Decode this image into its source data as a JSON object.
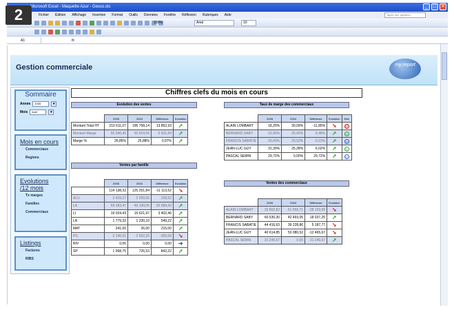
{
  "overlay_badge": "2",
  "window": {
    "title": "Microsoft Excel - Maquette Azur - Gesco.xls",
    "controls": [
      "_",
      "□",
      "✕"
    ]
  },
  "menu": [
    "Fichier",
    "Édition",
    "Affichage",
    "Insertion",
    "Format",
    "Outils",
    "Données",
    "Fenêtre",
    "Réflexion",
    "Rubriques",
    "Aide"
  ],
  "help_placeholder": "Tapez une question",
  "toolbar": {
    "zoom": "100%",
    "font": "Arial",
    "size": "10"
  },
  "formula_bar": {
    "cell": "A1",
    "fx": "fx"
  },
  "header": {
    "title": "Gestion commerciale",
    "logo": "my report"
  },
  "nav": {
    "sommaire": {
      "title": "Sommaire",
      "annee_label": "Année",
      "annee_value": "2005",
      "mois_label": "Mois",
      "mois_value": "Avril"
    },
    "ventes": {
      "title": "Mois en cours",
      "items": [
        "Commerciaux",
        "Regions"
      ]
    },
    "evolutions": {
      "title": "Evolutions",
      "subtitle": "/12 mois",
      "items": [
        "Tx marges",
        "Familles",
        "Commerciaux"
      ]
    },
    "listings": {
      "title": "Listings",
      "items": [
        "Factures",
        "RIBS"
      ]
    }
  },
  "main_title": "Chiffres clefs du mois en cours",
  "evolution": {
    "title": "Evolution des ventes",
    "headers": [
      "2005",
      "2004",
      "Différence",
      "Evolution"
    ],
    "rows": [
      {
        "label": "Montant Total HT",
        "v2005": "210 611,07",
        "v2004": "196 758,14",
        "diff": "13 852,93",
        "trend": "up",
        "alt": false
      },
      {
        "label": "Montant Marge",
        "v2005": "56 546,40",
        "v2004": "50 914,56",
        "diff": "5 631,84",
        "trend": "up",
        "alt": true
      },
      {
        "label": "Marge %",
        "v2005": "26,85%",
        "v2004": "25,88%",
        "diff": "0,97%",
        "trend": "up",
        "alt": false
      }
    ]
  },
  "familles": {
    "title": "Ventes par famille",
    "headers": [
      "2005",
      "2004",
      "Différence",
      "Evolution"
    ],
    "rows": [
      {
        "label": "",
        "v2005": "114 138,32",
        "v2004": "125 251,84",
        "diff": "-11 113,52",
        "trend": "down",
        "alt": false
      },
      {
        "label": "ALU",
        "v2005": "2 429,27",
        "v2004": "2 200,65",
        "diff": "228,62",
        "trend": "up",
        "alt": true
      },
      {
        "label": "LA",
        "v2005": "69 283,47",
        "v2004": "49 199,05",
        "diff": "20 084,42",
        "trend": "up",
        "alt": true
      },
      {
        "label": "LI",
        "v2005": "19 024,43",
        "v2004": "15 621,97",
        "diff": "3 402,46",
        "trend": "up",
        "alt": false
      },
      {
        "label": "LR",
        "v2005": "1 779,32",
        "v2004": "1 230,10",
        "diff": "549,22",
        "trend": "up",
        "alt": false
      },
      {
        "label": "MAT",
        "v2005": "241,00",
        "v2004": "26,00",
        "diff": "215,00",
        "trend": "up",
        "alt": false
      },
      {
        "label": "PS",
        "v2005": "2 146,51",
        "v2004": "2 502,20",
        "diff": "-355,69",
        "trend": "down",
        "alt": true
      },
      {
        "label": "RIV",
        "v2005": "0,00",
        "v2004": "0,00",
        "diff": "0,00",
        "trend": "flat",
        "alt": false
      },
      {
        "label": "SP",
        "v2005": "1 568,75",
        "v2004": "726,53",
        "diff": "842,22",
        "trend": "up",
        "alt": false
      }
    ]
  },
  "taux": {
    "title": "Taux de marge des commerciaux",
    "headers": [
      "2005",
      "2004",
      "Différence",
      "Evolution",
      "Etat"
    ],
    "rows": [
      {
        "label": "ALAIN LOMBART",
        "v2005": "18,25%",
        "v2004": "30,09%",
        "diff": "-11,85%",
        "trend": "down",
        "state": "bad",
        "alt": false
      },
      {
        "label": "BERNARD SABY",
        "v2005": "31,80%",
        "v2004": "25,42%",
        "diff": "6,48%",
        "trend": "up",
        "state": "good",
        "alt": true
      },
      {
        "label": "FRANCIS SABATIE",
        "v2005": "20,43%",
        "v2004": "20,53%",
        "diff": "-0,10%",
        "trend": "up",
        "state": "mid",
        "alt": true
      },
      {
        "label": "JEAN-LUC GUY",
        "v2005": "31,30%",
        "v2004": "25,28%",
        "diff": "6,02%",
        "trend": "up",
        "state": "good",
        "alt": false
      },
      {
        "label": "PASCAL SEMIN",
        "v2005": "29,72%",
        "v2004": "0,00%",
        "diff": "29,72%",
        "trend": "up",
        "state": "mid",
        "alt": false
      }
    ]
  },
  "commerciaux": {
    "title": "Ventes des commerciaux",
    "headers": [
      "2005",
      "2004",
      "Différence",
      "Evolution"
    ],
    "rows": [
      {
        "label": "ALAIN LOMBART",
        "v2005": "33 802,82",
        "v2004": "61 955,71",
        "diff": "-28 153,09",
        "trend": "down",
        "alt": true
      },
      {
        "label": "BERNARD SABY",
        "v2005": "60 530,30",
        "v2004": "42 493,05",
        "diff": "18 037,25",
        "trend": "up",
        "alt": false
      },
      {
        "label": "FRANCIS SABATIE",
        "v2005": "44 416,63",
        "v2004": "39 228,86",
        "diff": "5 187,77",
        "trend": "down",
        "alt": false
      },
      {
        "label": "JEAN-LUC GUY",
        "v2005": "40 614,85",
        "v2004": "53 080,52",
        "diff": "-12 465,67",
        "trend": "down",
        "alt": false
      },
      {
        "label": "PASCAL SEMIN",
        "v2005": "31 246,67",
        "v2004": "0,00",
        "diff": "31 246,67",
        "trend": "up",
        "alt": true
      }
    ]
  }
}
